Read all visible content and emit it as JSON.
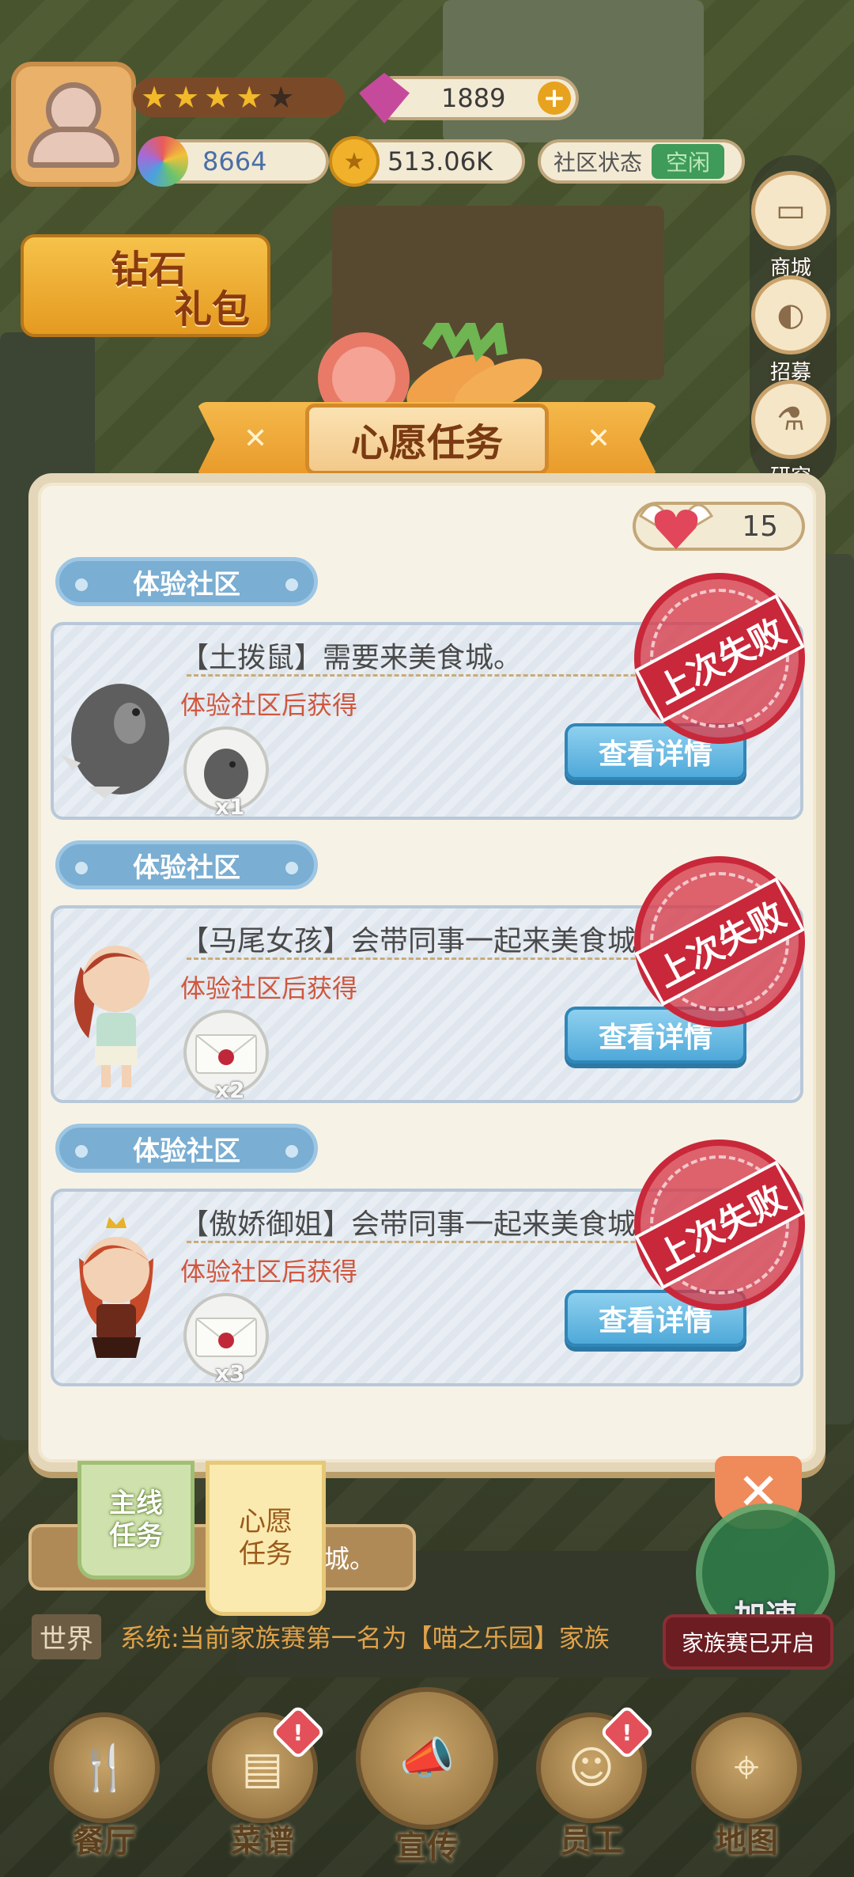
{
  "hud": {
    "stars_filled": 4,
    "gems": "1889",
    "cd_count": "8664",
    "coins": "513.06K",
    "status_label": "社区状态",
    "status_value": "空闲"
  },
  "side_menu": [
    {
      "label": "商城",
      "icon": "shop-icon"
    },
    {
      "label": "招募",
      "icon": "recruit-icon"
    },
    {
      "label": "研究",
      "icon": "research-icon"
    }
  ],
  "diamond_pack": {
    "line1": "钻石",
    "line2": "礼包"
  },
  "modal": {
    "title": "心愿任务",
    "hearts": "15",
    "tasks": [
      {
        "section": "体验社区",
        "title": "【土拨鼠】需要来美食城。",
        "subtitle": "体验社区后获得",
        "reward_qty": "x1",
        "button": "查看详情",
        "stamp": "上次失败",
        "char_icon": "groundhog-icon",
        "reward_icon": "groundhog-reward-icon"
      },
      {
        "section": "体验社区",
        "title": "【马尾女孩】会带同事一起来美食城",
        "subtitle": "体验社区后获得",
        "reward_qty": "x2",
        "button": "查看详情",
        "stamp": "上次失败",
        "char_icon": "ponytail-girl-icon",
        "reward_icon": "envelope-icon"
      },
      {
        "section": "体验社区",
        "title": "【傲娇御姐】会带同事一起来美食城",
        "subtitle": "体验社区后获得",
        "reward_qty": "x3",
        "button": "查看详情",
        "stamp": "上次失败",
        "char_icon": "queen-girl-icon",
        "reward_icon": "envelope-icon"
      }
    ]
  },
  "tabs": {
    "main": "主线\n任务",
    "wish": "心愿\n任务"
  },
  "quest_strip": "城。",
  "speed_label": "加速",
  "chat": {
    "tag": "世界",
    "text": "系统:当前家族赛第一名为【喵之乐园】家族",
    "popup": "家族赛已开启"
  },
  "nav": [
    {
      "label": "餐厅",
      "icon": "restaurant-icon"
    },
    {
      "label": "菜谱",
      "icon": "recipe-icon"
    },
    {
      "label": "宣传",
      "icon": "megaphone-icon"
    },
    {
      "label": "员工",
      "icon": "staff-icon"
    },
    {
      "label": "地图",
      "icon": "map-icon"
    }
  ],
  "colors": {
    "accent": "#e89a2a",
    "button_blue": "#4fa9d9",
    "stamp_red": "#c8283a"
  }
}
